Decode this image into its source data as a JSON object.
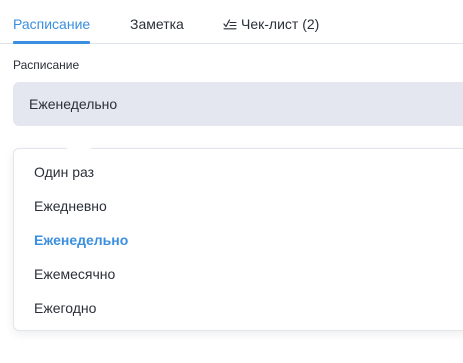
{
  "tabs": [
    {
      "label": "Расписание",
      "active": true
    },
    {
      "label": "Заметка",
      "active": false
    },
    {
      "label": "Чек-лист (2)",
      "icon": "checklist-icon",
      "active": false
    }
  ],
  "schedule": {
    "label": "Расписание",
    "selected_value": "Еженедельно"
  },
  "dropdown": {
    "options": [
      {
        "label": "Один раз",
        "selected": false
      },
      {
        "label": "Ежедневно",
        "selected": false
      },
      {
        "label": "Еженедельно",
        "selected": true
      },
      {
        "label": "Ежемесячно",
        "selected": false
      },
      {
        "label": "Ежегодно",
        "selected": false
      }
    ]
  },
  "colors": {
    "accent": "#3b8fe0",
    "select_background": "#e4e7ef",
    "text": "#2b2f38"
  }
}
